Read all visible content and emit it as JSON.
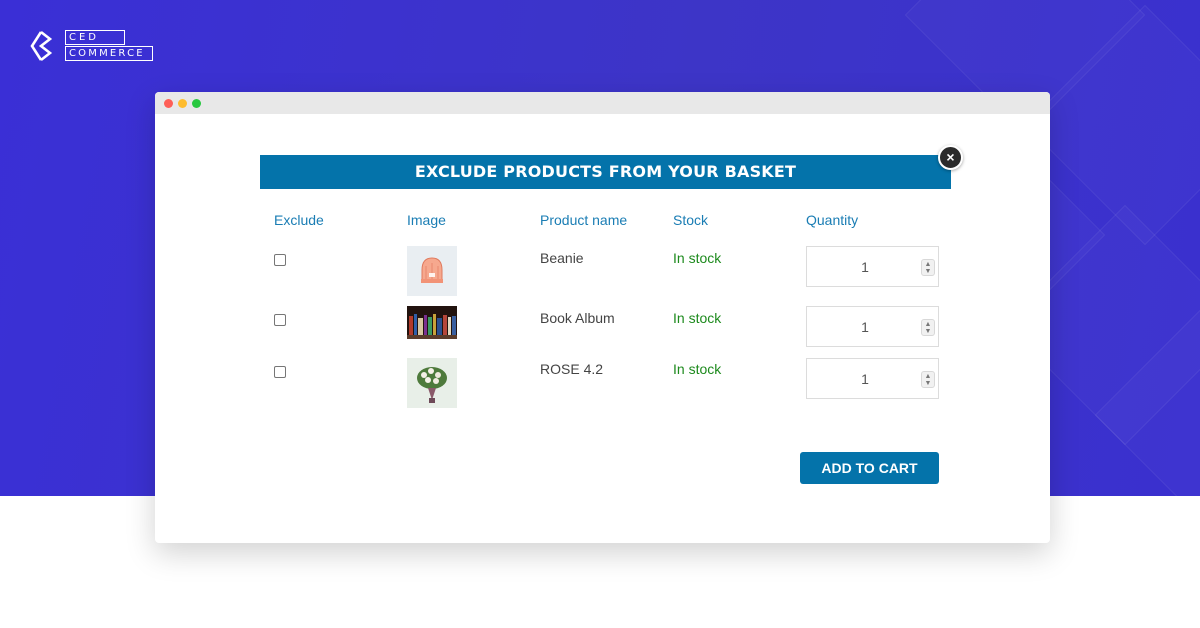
{
  "brand": {
    "logo_top": "CED",
    "logo_bottom": "COMMERCE",
    "bg_color": "#3a31d0"
  },
  "window": {
    "controls": [
      "close",
      "minimize",
      "maximize"
    ]
  },
  "modal": {
    "title": "EXCLUDE PRODUCTS FROM YOUR BASKET",
    "close_label": "×",
    "header_color": "#0473aa"
  },
  "table": {
    "headers": [
      "Exclude",
      "Image",
      "Product name",
      "Stock",
      "Quantity"
    ],
    "rows": [
      {
        "name": "Beanie",
        "stock": "In stock",
        "qty": "1",
        "checked": false,
        "image": "beanie-thumbnail"
      },
      {
        "name": "Book Album",
        "stock": "In stock",
        "qty": "1",
        "checked": false,
        "image": "books-thumbnail"
      },
      {
        "name": "ROSE 4.2",
        "stock": "In stock",
        "qty": "1",
        "checked": false,
        "image": "rose-bouquet-thumbnail"
      }
    ]
  },
  "actions": {
    "add_to_cart": "ADD TO CART"
  },
  "colors": {
    "header_text": "#1a7db4",
    "stock_text": "#1d8a1d",
    "button": "#0473aa"
  }
}
